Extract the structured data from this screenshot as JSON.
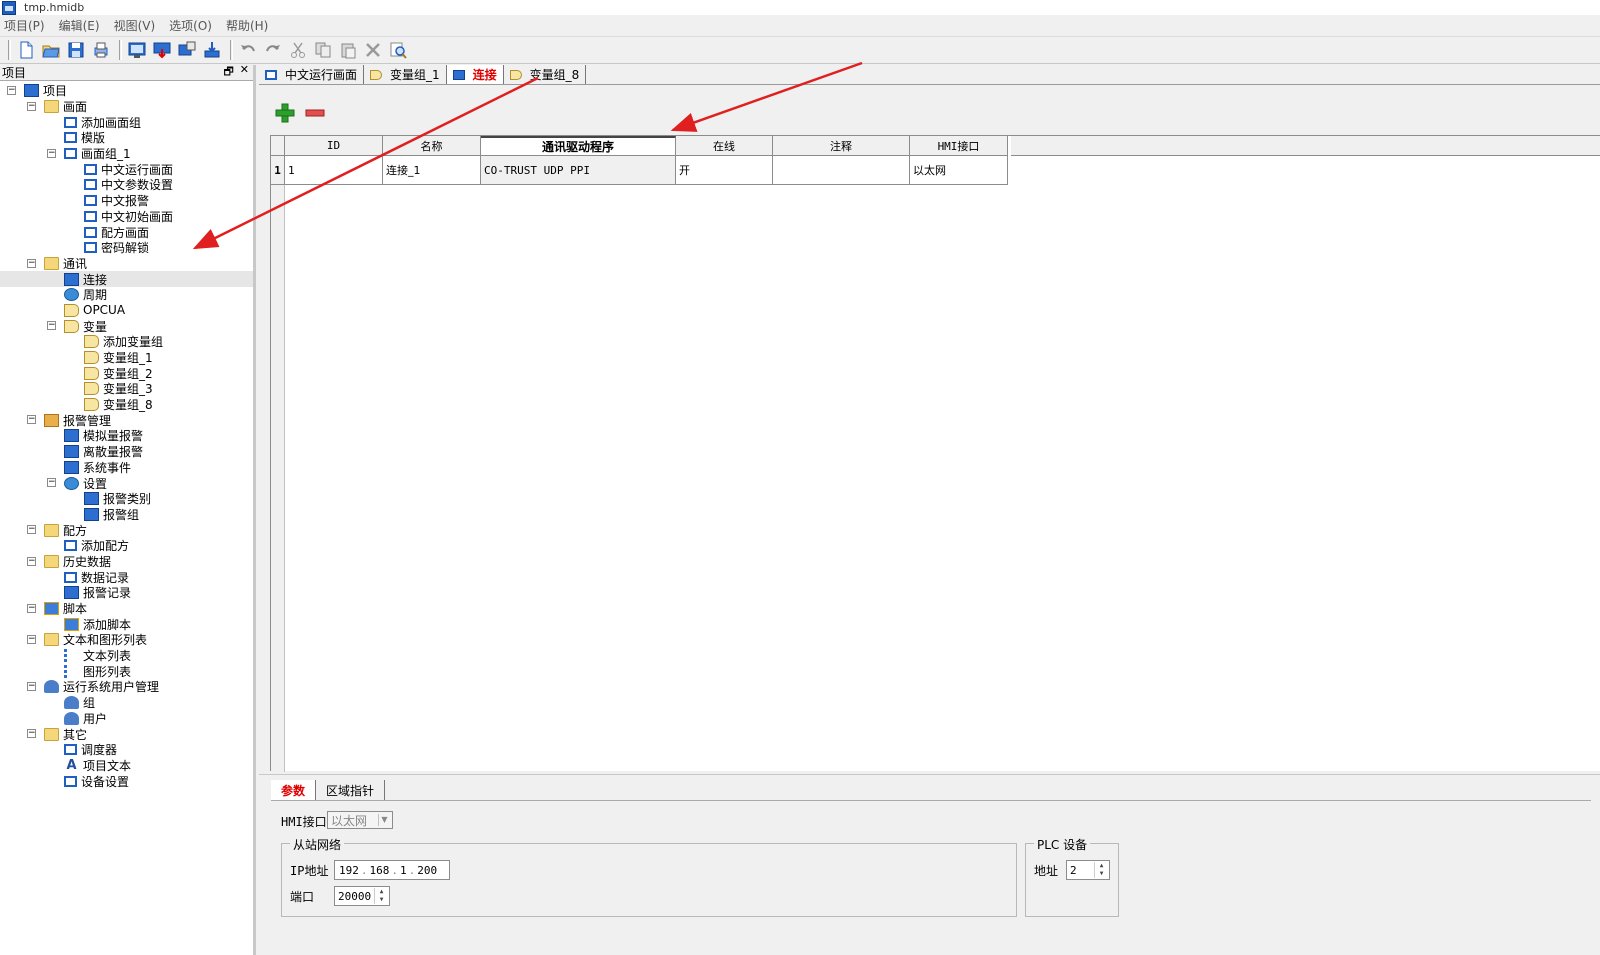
{
  "window": {
    "title": "tmp.hmidb"
  },
  "menu": [
    "项目(P)",
    "编辑(E)",
    "视图(V)",
    "选项(O)",
    "帮助(H)"
  ],
  "toolbar": {
    "icons": [
      "new-file-icon",
      "open-folder-icon",
      "save-icon",
      "print-icon",
      "compile-icon",
      "download-icon",
      "simulate-icon",
      "transfer-icon",
      "undo-icon",
      "redo-icon",
      "cut-icon",
      "copy-icon",
      "paste-icon",
      "delete-icon",
      "find-icon"
    ]
  },
  "project_panel": {
    "title": "项目",
    "pin_label": "🗗",
    "close_label": "✕",
    "tree": [
      {
        "label": "项目",
        "level": 0,
        "icon": "blue",
        "exp": "−"
      },
      {
        "label": "画面",
        "level": 1,
        "icon": "folder",
        "exp": "−"
      },
      {
        "label": "添加画面组",
        "level": 2,
        "icon": "screen"
      },
      {
        "label": "模版",
        "level": 2,
        "icon": "screen"
      },
      {
        "label": "画面组_1",
        "level": 2,
        "icon": "screen",
        "exp": "−"
      },
      {
        "label": "中文运行画面",
        "level": 3,
        "icon": "screen"
      },
      {
        "label": "中文参数设置",
        "level": 3,
        "icon": "screen"
      },
      {
        "label": "中文报警",
        "level": 3,
        "icon": "screen"
      },
      {
        "label": "中文初始画面",
        "level": 3,
        "icon": "screen"
      },
      {
        "label": "配方画面",
        "level": 3,
        "icon": "screen"
      },
      {
        "label": "密码解锁",
        "level": 3,
        "icon": "screen"
      },
      {
        "label": "通讯",
        "level": 1,
        "icon": "folder",
        "exp": "−"
      },
      {
        "label": "连接",
        "level": 2,
        "icon": "blue",
        "selected": true
      },
      {
        "label": "周期",
        "level": 2,
        "icon": "gear"
      },
      {
        "label": "OPCUA",
        "level": 2,
        "icon": "tag"
      },
      {
        "label": "变量",
        "level": 2,
        "icon": "tag",
        "exp": "−"
      },
      {
        "label": "添加变量组",
        "level": 3,
        "icon": "tag"
      },
      {
        "label": "变量组_1",
        "level": 3,
        "icon": "tag"
      },
      {
        "label": "变量组_2",
        "level": 3,
        "icon": "tag"
      },
      {
        "label": "变量组_3",
        "level": 3,
        "icon": "tag"
      },
      {
        "label": "变量组_8",
        "level": 3,
        "icon": "tag"
      },
      {
        "label": "报警管理",
        "level": 1,
        "icon": "red",
        "exp": "−"
      },
      {
        "label": "模拟量报警",
        "level": 2,
        "icon": "blue"
      },
      {
        "label": "离散量报警",
        "level": 2,
        "icon": "blue"
      },
      {
        "label": "系统事件",
        "level": 2,
        "icon": "blue"
      },
      {
        "label": "设置",
        "level": 2,
        "icon": "gear",
        "exp": "−"
      },
      {
        "label": "报警类别",
        "level": 3,
        "icon": "blue"
      },
      {
        "label": "报警组",
        "level": 3,
        "icon": "blue"
      },
      {
        "label": "配方",
        "level": 1,
        "icon": "folder",
        "exp": "−"
      },
      {
        "label": "添加配方",
        "level": 2,
        "icon": "screen"
      },
      {
        "label": "历史数据",
        "level": 1,
        "icon": "folder",
        "exp": "−"
      },
      {
        "label": "数据记录",
        "level": 2,
        "icon": "screen"
      },
      {
        "label": "报警记录",
        "level": 2,
        "icon": "blue"
      },
      {
        "label": "脚本",
        "level": 1,
        "icon": "script",
        "exp": "−"
      },
      {
        "label": "添加脚本",
        "level": 2,
        "icon": "script"
      },
      {
        "label": "文本和图形列表",
        "level": 1,
        "icon": "folder",
        "exp": "−"
      },
      {
        "label": "文本列表",
        "level": 2,
        "icon": "list"
      },
      {
        "label": "图形列表",
        "level": 2,
        "icon": "list"
      },
      {
        "label": "运行系统用户管理",
        "level": 1,
        "icon": "user",
        "exp": "−"
      },
      {
        "label": "组",
        "level": 2,
        "icon": "user"
      },
      {
        "label": "用户",
        "level": 2,
        "icon": "user"
      },
      {
        "label": "其它",
        "level": 1,
        "icon": "folder",
        "exp": "−"
      },
      {
        "label": "调度器",
        "level": 2,
        "icon": "screen"
      },
      {
        "label": "项目文本",
        "level": 2,
        "icon": "A"
      },
      {
        "label": "设备设置",
        "level": 2,
        "icon": "screen"
      }
    ]
  },
  "doc_tabs": [
    {
      "label": "中文运行画面",
      "icon": "screen"
    },
    {
      "label": "变量组_1",
      "icon": "tag"
    },
    {
      "label": "连接",
      "icon": "blue",
      "active": true
    },
    {
      "label": "变量组_8",
      "icon": "tag"
    }
  ],
  "connections_table": {
    "columns": [
      "ID",
      "名称",
      "通讯驱动程序",
      "在线",
      "注释",
      "HMI接口"
    ],
    "rows": [
      {
        "num": "1",
        "id": "1",
        "name": "连接_1",
        "driver": "CO-TRUST UDP PPI",
        "online": "开",
        "comment": "",
        "hmi_interface": "以太网"
      }
    ]
  },
  "properties": {
    "tabs": [
      {
        "label": "参数",
        "active": true
      },
      {
        "label": "区域指针"
      }
    ],
    "hmi_interface_label": "HMI接口",
    "hmi_interface_value": "以太网",
    "slave_network": {
      "title": "从站网络",
      "ip_label": "IP地址",
      "ip": [
        "192",
        "168",
        "1",
        "200"
      ],
      "port_label": "端口",
      "port": "20000"
    },
    "plc_device": {
      "title": "PLC 设备",
      "address_label": "地址",
      "address": "2"
    }
  },
  "colors": {
    "accent_red": "#e00000",
    "arrow_red": "#e02020",
    "add_green": "#2ca02c",
    "remove_red": "#e05050"
  }
}
